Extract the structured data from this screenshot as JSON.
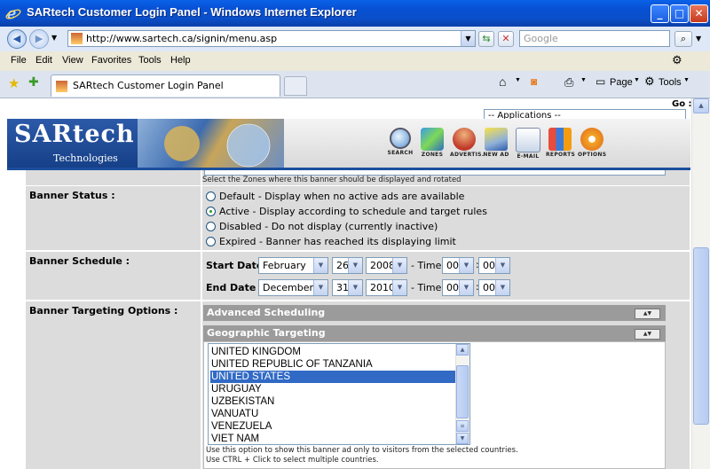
{
  "window": {
    "title": "SARtech Customer Login Panel - Windows Internet Explorer"
  },
  "address": {
    "url": "http://www.sartech.ca/signin/menu.asp",
    "search_placeholder": "Google"
  },
  "menu": [
    "File",
    "Edit",
    "View",
    "Favorites",
    "Tools",
    "Help"
  ],
  "tab": {
    "title": "SARtech Customer Login Panel"
  },
  "toolbar": {
    "page_label": "Page",
    "tools_label": "Tools"
  },
  "header": {
    "go_label": "Go :",
    "apps_select": "-- Applications --",
    "logo_main": "SARtech",
    "logo_sub": "Technologies",
    "nav": [
      "SEARCH",
      "ZONES",
      "ADVERTIS.",
      "NEW AD",
      "E-MAIL",
      "REPORTS",
      "OPTIONS"
    ]
  },
  "zones_note": "Select the Zones where this banner should be displayed and rotated",
  "banner_status": {
    "label": "Banner Status :",
    "options": [
      {
        "text": "Default - Display when no active ads are available",
        "checked": false
      },
      {
        "text": "Active - Display according to schedule and target rules",
        "checked": true
      },
      {
        "text": "Disabled - Do not display (currently inactive)",
        "checked": false
      },
      {
        "text": "Expired - Banner has reached its displaying limit",
        "checked": false
      }
    ]
  },
  "banner_schedule": {
    "label": "Banner Schedule :",
    "start_label": "Start Date :",
    "end_label": "End Date :",
    "time_label": "- Time",
    "colon": ":",
    "start": {
      "month": "February",
      "day": "26",
      "year": "2008",
      "hour": "00",
      "minute": "00"
    },
    "end": {
      "month": "December",
      "day": "31",
      "year": "2010",
      "hour": "00",
      "minute": "00"
    }
  },
  "targeting": {
    "label": "Banner Targeting Options :",
    "advanced_scheduling": "Advanced Scheduling",
    "geographic_targeting": "Geographic Targeting",
    "countries": [
      "UNITED KINGDOM",
      "UNITED REPUBLIC OF TANZANIA",
      "UNITED STATES",
      "URUGUAY",
      "UZBEKISTAN",
      "VANUATU",
      "VENEZUELA",
      "VIET NAM"
    ],
    "selected_country": "UNITED STATES",
    "note_1": "Use this option to show this banner ad only to visitors from the selected countries.",
    "note_2": "Use CTRL + Click to select multiple countries."
  }
}
